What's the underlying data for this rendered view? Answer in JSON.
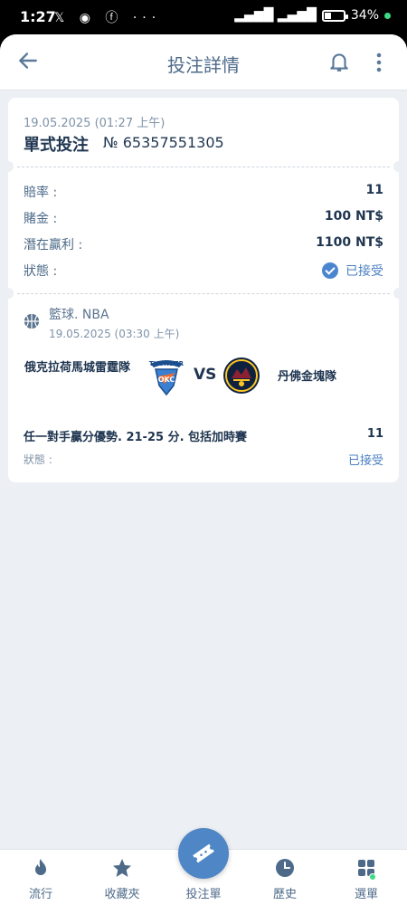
{
  "status_bar": {
    "time": "1:27",
    "left_icons": "𝕏 ◉ ⓕ ···",
    "right_text": "34%"
  },
  "header": {
    "title": "投注詳情"
  },
  "bet": {
    "date": "19.05.2025 (01:27 上午)",
    "type": "單式投注",
    "number": "№ 65357551305",
    "odds_label": "賠率 :",
    "odds_value": "11",
    "stake_label": "賭金 :",
    "stake_value": "100 NT$",
    "potential_label": "潛在贏利 :",
    "potential_value": "1100 NT$",
    "status_label": "狀態 :",
    "status_value": "已接受"
  },
  "event": {
    "league": "籃球. NBA",
    "date": "19.05.2025 (03:30 上午)",
    "home_team": "俄克拉荷馬城雷霆隊",
    "vs": "VS",
    "away_team": "丹佛金塊隊",
    "selection": "任一對手贏分優勢. 21-25 分. 包括加時賽",
    "selection_odds": "11",
    "status_label": "狀態 :",
    "status_value": "已接受"
  },
  "nav": {
    "items": [
      {
        "label": "流行",
        "icon": "flame-icon"
      },
      {
        "label": "收藏夾",
        "icon": "star-icon"
      },
      {
        "label": "投注單",
        "icon": "ticket-icon"
      },
      {
        "label": "歷史",
        "icon": "clock-icon"
      },
      {
        "label": "選單",
        "icon": "grid-icon"
      }
    ]
  },
  "colors": {
    "accent": "#4f86c6",
    "text_dark": "#1f3550",
    "text_muted": "#4d6a89",
    "background": "#eceff3"
  }
}
